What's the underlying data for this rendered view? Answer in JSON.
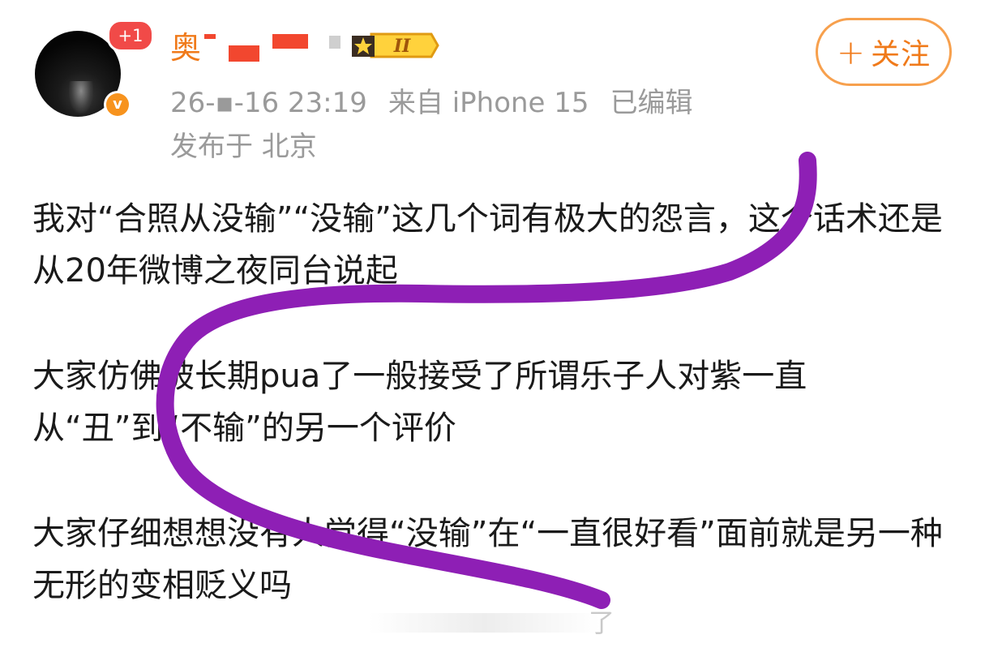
{
  "header": {
    "notification_badge": "+1",
    "username": "奥",
    "timestamp": "26-▪-16 23:19",
    "source": "来自 iPhone 15",
    "edited": "已编辑",
    "location": "发布于 北京",
    "follow_label": "关注",
    "follow_icon": "plus-icon",
    "level_badge": "II",
    "verified_icon": "verified-v-icon"
  },
  "post": {
    "paragraphs": [
      "我对“合照从没输”“没输”这几个词有极大的怨言，这个话术还是从20年微博之夜同台说起",
      "大家仿佛被长期pua了一般接受了所谓乐子人对紫一直从“丑”到“不输”的另一个评价",
      "大家仔细想想没有人觉得“没输”在“一直很好看”面前就是另一种无形的变相贬义吗"
    ],
    "faded_tail": "了"
  },
  "colors": {
    "accent": "#f07a1a",
    "meta_gray": "#9a9a9a",
    "scribble": "#8e1fb5",
    "badge_red": "#f14a48"
  }
}
